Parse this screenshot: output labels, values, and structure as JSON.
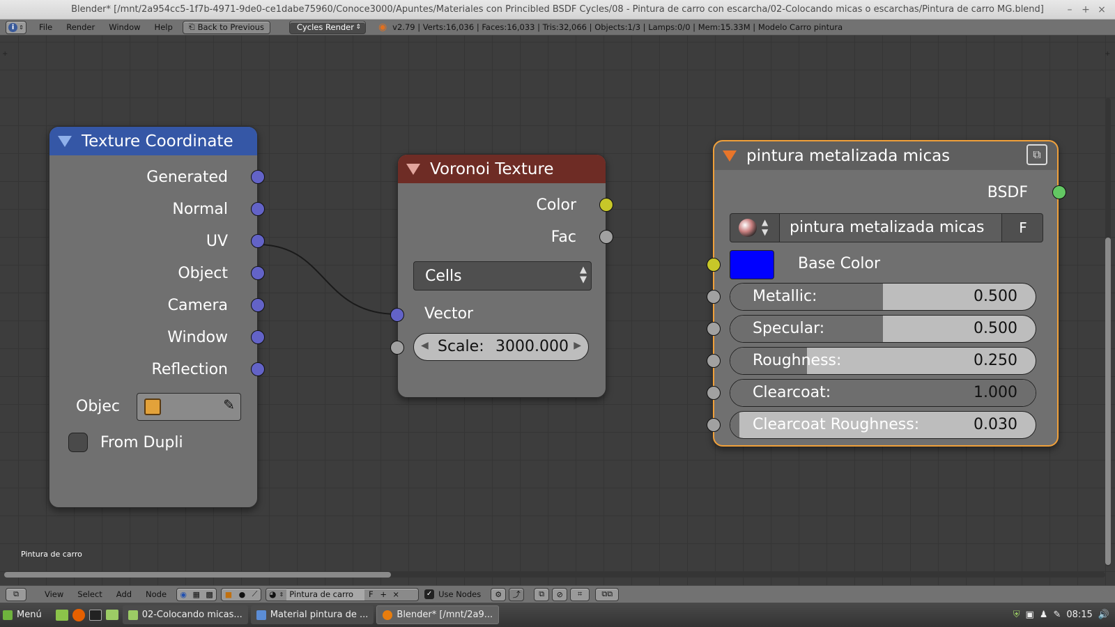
{
  "window": {
    "title": "Blender* [/mnt/2a954cc5-1f7b-4971-9de0-ce1dabe75960/Conoce3000/Apuntes/Materiales con Princibled BSDF Cycles/08 - Pintura de carro con escarcha/02-Colocando micas o escarchas/Pintura de carro MG.blend]",
    "minimize": "–",
    "maximize": "+",
    "close": "×"
  },
  "topbar": {
    "menus": [
      "File",
      "Render",
      "Window",
      "Help"
    ],
    "back_button": "Back to Previous",
    "engine": "Cycles Render",
    "stats": "v2.79 | Verts:16,036 | Faces:16,033 | Tris:32,066 | Objects:1/3 | Lamps:0/0 | Mem:15.33M | Modelo Carro pintura"
  },
  "nodes": {
    "texture_coordinate": {
      "title": "Texture Coordinate",
      "outputs": [
        "Generated",
        "Normal",
        "UV",
        "Object",
        "Camera",
        "Window",
        "Reflection"
      ],
      "object_label": "Objec",
      "from_dupli": "From Dupli"
    },
    "voronoi": {
      "title": "Voronoi Texture",
      "out_color": "Color",
      "out_fac": "Fac",
      "coloring": "Cells",
      "in_vector": "Vector",
      "scale_label": "Scale:",
      "scale_value": "3000.000"
    },
    "material": {
      "title": "pintura metalizada micas",
      "out_bsdf": "BSDF",
      "material_name": "pintura metalizada micas",
      "fake_user": "F",
      "base_color_label": "Base Color",
      "base_color": "#0000ff",
      "sliders": [
        {
          "label": "Metallic:",
          "value": "0.500",
          "fraction": 0.5
        },
        {
          "label": "Specular:",
          "value": "0.500",
          "fraction": 0.5
        },
        {
          "label": "Roughness:",
          "value": "0.250",
          "fraction": 0.25
        },
        {
          "label": "Clearcoat:",
          "value": "1.000",
          "fraction": 1.0
        },
        {
          "label": "Clearcoat Roughness:",
          "value": "0.030",
          "fraction": 0.03
        }
      ]
    }
  },
  "editor": {
    "material_label": "Pintura de carro"
  },
  "bottombar": {
    "menus": [
      "View",
      "Select",
      "Add",
      "Node"
    ],
    "material": "Pintura de carro",
    "fake_user": "F",
    "use_nodes": "Use Nodes"
  },
  "taskbar": {
    "start": "Menú",
    "tasks": [
      "02-Colocando micas...",
      "Material pintura de ...",
      "Blender* [/mnt/2a9..."
    ],
    "clock": "08:15"
  },
  "colors": {
    "texture_header": "#3557a6",
    "voronoi_header": "#6e2c25",
    "shader_header": "#5f5f5f",
    "selected_outline": "#f0a03a"
  }
}
